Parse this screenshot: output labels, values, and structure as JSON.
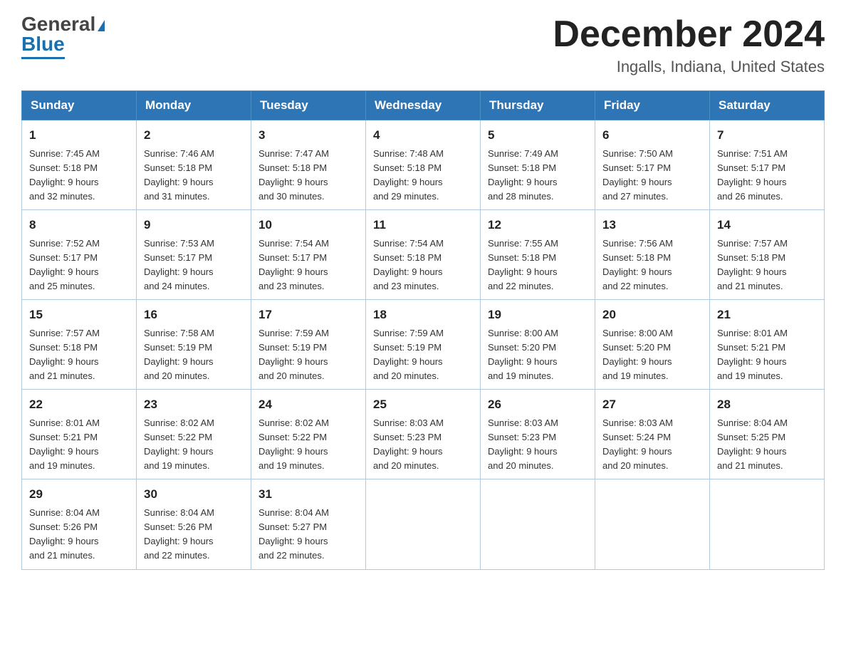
{
  "header": {
    "logo_general": "General",
    "logo_blue": "Blue",
    "month_title": "December 2024",
    "location": "Ingalls, Indiana, United States"
  },
  "days_of_week": [
    "Sunday",
    "Monday",
    "Tuesday",
    "Wednesday",
    "Thursday",
    "Friday",
    "Saturday"
  ],
  "weeks": [
    [
      {
        "day": "1",
        "sunrise": "7:45 AM",
        "sunset": "5:18 PM",
        "daylight": "9 hours and 32 minutes."
      },
      {
        "day": "2",
        "sunrise": "7:46 AM",
        "sunset": "5:18 PM",
        "daylight": "9 hours and 31 minutes."
      },
      {
        "day": "3",
        "sunrise": "7:47 AM",
        "sunset": "5:18 PM",
        "daylight": "9 hours and 30 minutes."
      },
      {
        "day": "4",
        "sunrise": "7:48 AM",
        "sunset": "5:18 PM",
        "daylight": "9 hours and 29 minutes."
      },
      {
        "day": "5",
        "sunrise": "7:49 AM",
        "sunset": "5:18 PM",
        "daylight": "9 hours and 28 minutes."
      },
      {
        "day": "6",
        "sunrise": "7:50 AM",
        "sunset": "5:17 PM",
        "daylight": "9 hours and 27 minutes."
      },
      {
        "day": "7",
        "sunrise": "7:51 AM",
        "sunset": "5:17 PM",
        "daylight": "9 hours and 26 minutes."
      }
    ],
    [
      {
        "day": "8",
        "sunrise": "7:52 AM",
        "sunset": "5:17 PM",
        "daylight": "9 hours and 25 minutes."
      },
      {
        "day": "9",
        "sunrise": "7:53 AM",
        "sunset": "5:17 PM",
        "daylight": "9 hours and 24 minutes."
      },
      {
        "day": "10",
        "sunrise": "7:54 AM",
        "sunset": "5:17 PM",
        "daylight": "9 hours and 23 minutes."
      },
      {
        "day": "11",
        "sunrise": "7:54 AM",
        "sunset": "5:18 PM",
        "daylight": "9 hours and 23 minutes."
      },
      {
        "day": "12",
        "sunrise": "7:55 AM",
        "sunset": "5:18 PM",
        "daylight": "9 hours and 22 minutes."
      },
      {
        "day": "13",
        "sunrise": "7:56 AM",
        "sunset": "5:18 PM",
        "daylight": "9 hours and 22 minutes."
      },
      {
        "day": "14",
        "sunrise": "7:57 AM",
        "sunset": "5:18 PM",
        "daylight": "9 hours and 21 minutes."
      }
    ],
    [
      {
        "day": "15",
        "sunrise": "7:57 AM",
        "sunset": "5:18 PM",
        "daylight": "9 hours and 21 minutes."
      },
      {
        "day": "16",
        "sunrise": "7:58 AM",
        "sunset": "5:19 PM",
        "daylight": "9 hours and 20 minutes."
      },
      {
        "day": "17",
        "sunrise": "7:59 AM",
        "sunset": "5:19 PM",
        "daylight": "9 hours and 20 minutes."
      },
      {
        "day": "18",
        "sunrise": "7:59 AM",
        "sunset": "5:19 PM",
        "daylight": "9 hours and 20 minutes."
      },
      {
        "day": "19",
        "sunrise": "8:00 AM",
        "sunset": "5:20 PM",
        "daylight": "9 hours and 19 minutes."
      },
      {
        "day": "20",
        "sunrise": "8:00 AM",
        "sunset": "5:20 PM",
        "daylight": "9 hours and 19 minutes."
      },
      {
        "day": "21",
        "sunrise": "8:01 AM",
        "sunset": "5:21 PM",
        "daylight": "9 hours and 19 minutes."
      }
    ],
    [
      {
        "day": "22",
        "sunrise": "8:01 AM",
        "sunset": "5:21 PM",
        "daylight": "9 hours and 19 minutes."
      },
      {
        "day": "23",
        "sunrise": "8:02 AM",
        "sunset": "5:22 PM",
        "daylight": "9 hours and 19 minutes."
      },
      {
        "day": "24",
        "sunrise": "8:02 AM",
        "sunset": "5:22 PM",
        "daylight": "9 hours and 19 minutes."
      },
      {
        "day": "25",
        "sunrise": "8:03 AM",
        "sunset": "5:23 PM",
        "daylight": "9 hours and 20 minutes."
      },
      {
        "day": "26",
        "sunrise": "8:03 AM",
        "sunset": "5:23 PM",
        "daylight": "9 hours and 20 minutes."
      },
      {
        "day": "27",
        "sunrise": "8:03 AM",
        "sunset": "5:24 PM",
        "daylight": "9 hours and 20 minutes."
      },
      {
        "day": "28",
        "sunrise": "8:04 AM",
        "sunset": "5:25 PM",
        "daylight": "9 hours and 21 minutes."
      }
    ],
    [
      {
        "day": "29",
        "sunrise": "8:04 AM",
        "sunset": "5:26 PM",
        "daylight": "9 hours and 21 minutes."
      },
      {
        "day": "30",
        "sunrise": "8:04 AM",
        "sunset": "5:26 PM",
        "daylight": "9 hours and 22 minutes."
      },
      {
        "day": "31",
        "sunrise": "8:04 AM",
        "sunset": "5:27 PM",
        "daylight": "9 hours and 22 minutes."
      },
      null,
      null,
      null,
      null
    ]
  ],
  "labels": {
    "sunrise": "Sunrise:",
    "sunset": "Sunset:",
    "daylight": "Daylight:"
  }
}
